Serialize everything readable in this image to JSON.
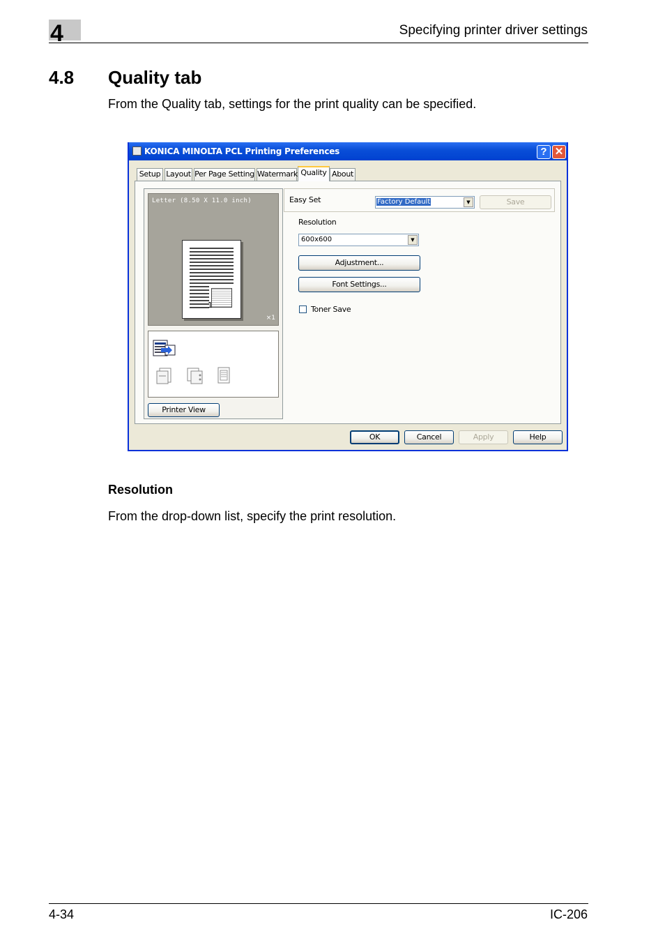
{
  "page": {
    "chapter_number": "4",
    "header_title": "Specifying printer driver settings",
    "section_number": "4.8",
    "section_title": "Quality tab",
    "intro": "From the Quality tab, settings for the print quality can be specified.",
    "subheading": "Resolution",
    "subtext": "From the drop-down list, specify the print resolution.",
    "footer_left": "4-34",
    "footer_right": "IC-206"
  },
  "dialog": {
    "title": "KONICA MINOLTA PCL Printing Preferences",
    "help_label": "?",
    "close_label": "✕",
    "tabs": [
      {
        "label": "Setup"
      },
      {
        "label": "Layout"
      },
      {
        "label": "Per Page Setting"
      },
      {
        "label": "Watermark"
      },
      {
        "label": "Quality",
        "active": true
      },
      {
        "label": "About"
      }
    ],
    "preview": {
      "paper_label": "Letter (8.50 X 11.0 inch)",
      "page_number": "1",
      "copies": "×1",
      "printer_view_label": "Printer View"
    },
    "settings": {
      "easy_set_label": "Easy Set",
      "easy_set_value": "Factory Default",
      "save_label": "Save",
      "resolution_label": "Resolution",
      "resolution_value": "600x600",
      "adjustment_label": "Adjustment...",
      "font_settings_label": "Font Settings...",
      "toner_save_label": "Toner Save",
      "toner_save_checked": false
    },
    "footer_buttons": {
      "ok": "OK",
      "cancel": "Cancel",
      "apply": "Apply",
      "help": "Help"
    }
  },
  "colors": {
    "titlebar": "#0a4fd8",
    "dialog_bg": "#ece9d8",
    "preview_gray": "#a6a49b",
    "chapter_box": "#c8c8c8"
  }
}
